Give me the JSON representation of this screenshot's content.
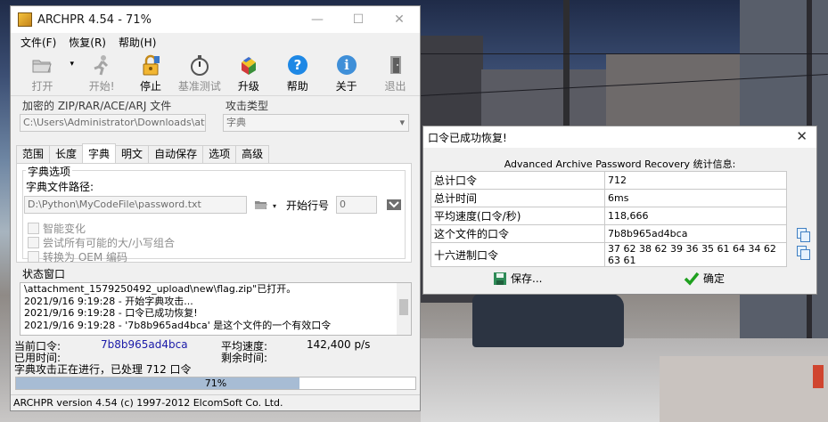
{
  "main_window": {
    "title": "ARCHPR 4.54 - 71%",
    "controls": {
      "minimize": "—",
      "maximize": "☐",
      "close": "✕"
    },
    "menu": [
      "文件(F)",
      "恢复(R)",
      "帮助(H)"
    ],
    "toolbar": {
      "open": "打开",
      "start": "开始!",
      "stop": "停止",
      "benchmark": "基准测试",
      "upgrade": "升级",
      "help": "帮助",
      "about": "关于",
      "exit": "退出"
    },
    "encrypted_file_label": "加密的 ZIP/RAR/ACE/ARJ 文件",
    "encrypted_file_path": "C:\\Users\\Administrator\\Downloads\\attach",
    "attack_type_label": "攻击类型",
    "attack_type_value": "字典",
    "tabs": [
      "范围",
      "长度",
      "字典",
      "明文",
      "自动保存",
      "选项",
      "高级"
    ],
    "active_tab": "字典",
    "dict_group_label": "字典选项",
    "dict_path_label": "字典文件路径:",
    "dict_path_value": "D:\\Python\\MyCodeFile\\password.txt",
    "start_line_label": "开始行号",
    "start_line_value": "0",
    "options": [
      "智能变化",
      "尝试所有可能的大/小写组合",
      "转换为 OEM 编码"
    ],
    "status_label": "状态窗口",
    "log": [
      "\\attachment_1579250492_upload\\new\\flag.zip\"已打开。",
      "2021/9/16 9:19:28 - 开始字典攻击...",
      "2021/9/16 9:19:28 - 口令已成功恢复!",
      "2021/9/16 9:19:28 - '7b8b965ad4bca' 是这个文件的一个有效口令"
    ],
    "current_password_label": "当前口令:",
    "current_password_value": "7b8b965ad4bca",
    "avg_speed_label": "平均速度:",
    "avg_speed_value": "142,400 p/s",
    "elapsed_label": "已用时间:",
    "remaining_label": "剩余时间:",
    "status_text": "字典攻击正在进行，已处理 712 口令",
    "progress_percent": 71,
    "progress_text": "71%",
    "footer": "ARCHPR version 4.54 (c) 1997-2012 ElcomSoft Co. Ltd."
  },
  "dialog": {
    "title": "口令已成功恢复!",
    "header": "Advanced Archive Password Recovery 统计信息:",
    "rows": [
      {
        "key": "总计口令",
        "value": "712"
      },
      {
        "key": "总计时间",
        "value": "6ms"
      },
      {
        "key": "平均速度(口令/秒)",
        "value": "118,666"
      },
      {
        "key": "这个文件的口令",
        "value": "7b8b965ad4bca"
      },
      {
        "key": "十六进制口令",
        "value": "37 62 38 62 39 36 35 61 64 34 62 63 61"
      }
    ],
    "save_label": "保存...",
    "ok_label": "确定",
    "close": "✕"
  },
  "colors": {
    "progress_fill": "#a7bcd4",
    "password_blue": "#1a1aa8",
    "help_icon": "#1e88e5",
    "ok_check": "#1fa01f",
    "save_icon": "#2e8b57"
  }
}
